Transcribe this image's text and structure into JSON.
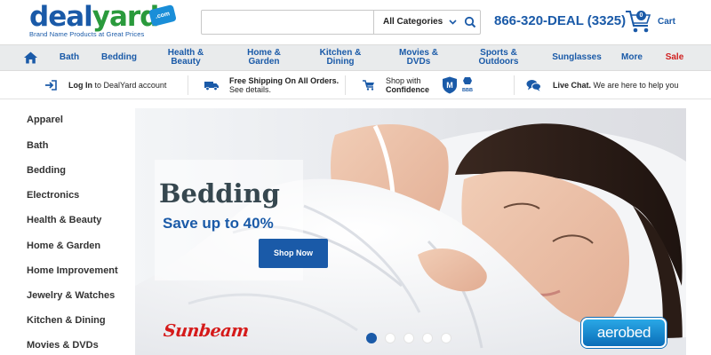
{
  "header": {
    "logo": {
      "part1": "deal",
      "part2": "yard",
      "badge": ".com",
      "tagline": "Brand Name Products at Great Prices"
    },
    "search": {
      "placeholder": "",
      "category": "All Categories"
    },
    "phone": "866-320-DEAL (3325)",
    "cart": {
      "count": "0",
      "label": "Cart"
    }
  },
  "nav": {
    "items": [
      {
        "label": "Bath"
      },
      {
        "label": "Bedding"
      },
      {
        "label": "Health &\nBeauty"
      },
      {
        "label": "Home &\nGarden"
      },
      {
        "label": "Kitchen &\nDining"
      },
      {
        "label": "Movies &\nDVDs"
      },
      {
        "label": "Sports &\nOutdoors"
      },
      {
        "label": "Sunglasses"
      },
      {
        "label": "More"
      },
      {
        "label": "Sale"
      }
    ]
  },
  "info_bar": {
    "login": {
      "bold": "Log In",
      "rest": " to DealYard account"
    },
    "shipping": {
      "bold": "Free Shipping On All Orders.",
      "rest": "See details."
    },
    "confidence": {
      "line1": "Shop with",
      "line2": "Confidence"
    },
    "chat": {
      "bold": "Live Chat.",
      "rest": " We are here to help you"
    }
  },
  "sidebar": {
    "items": [
      {
        "label": "Apparel"
      },
      {
        "label": "Bath"
      },
      {
        "label": "Bedding"
      },
      {
        "label": "Electronics"
      },
      {
        "label": "Health & Beauty"
      },
      {
        "label": "Home & Garden"
      },
      {
        "label": "Home Improvement"
      },
      {
        "label": "Jewelry & Watches"
      },
      {
        "label": "Kitchen & Dining"
      },
      {
        "label": "Movies & DVDs"
      }
    ]
  },
  "hero": {
    "title": "Bedding",
    "subtitle": "Save up to 40%",
    "cta": "Shop Now",
    "brand_left": "Sunbeam",
    "brand_right": "aerobed",
    "slides": {
      "count": 5,
      "active": 1
    }
  },
  "colors": {
    "brand_blue": "#1a5aa8",
    "brand_green": "#2a9a3c",
    "sale_red": "#d02020",
    "nav_bg": "#e9ebec"
  },
  "icons": [
    "home-icon",
    "search-icon",
    "cart-icon",
    "login-icon",
    "truck-icon",
    "cart-icon",
    "shield-icon",
    "chat-icon",
    "chevron-down-icon"
  ]
}
